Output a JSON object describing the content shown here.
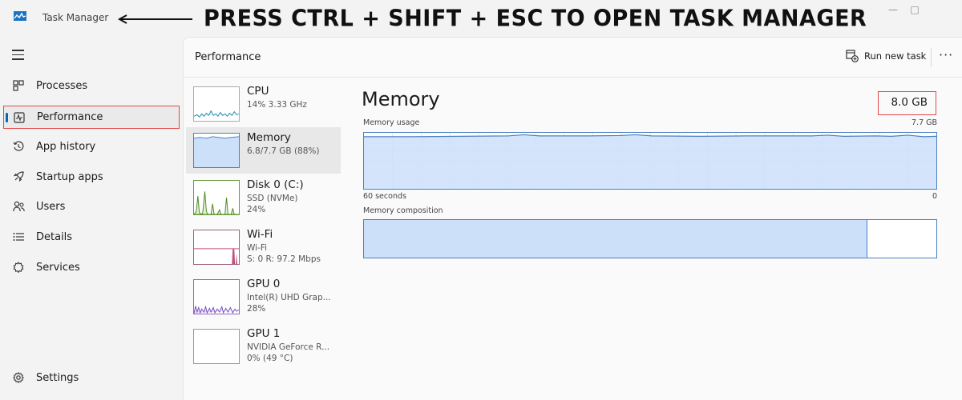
{
  "window": {
    "title": "Task Manager",
    "annotation": "PRESS CTRL + SHIFT + ESC TO OPEN TASK MANAGER",
    "minimize": "—",
    "maximize": "□"
  },
  "sidebar": {
    "items": [
      {
        "label": "Processes",
        "icon": "processes-icon"
      },
      {
        "label": "Performance",
        "icon": "performance-icon",
        "active": true
      },
      {
        "label": "App history",
        "icon": "history-icon"
      },
      {
        "label": "Startup apps",
        "icon": "startup-icon"
      },
      {
        "label": "Users",
        "icon": "users-icon"
      },
      {
        "label": "Details",
        "icon": "details-icon"
      },
      {
        "label": "Services",
        "icon": "services-icon"
      }
    ],
    "settings": "Settings"
  },
  "header": {
    "title": "Performance",
    "run_new_task": "Run new task",
    "more": "···"
  },
  "resources": [
    {
      "name": "CPU",
      "sub": "14% 3.33 GHz",
      "sub2": ""
    },
    {
      "name": "Memory",
      "sub": "6.8/7.7 GB (88%)",
      "sub2": ""
    },
    {
      "name": "Disk 0 (C:)",
      "sub": "SSD (NVMe)",
      "sub2": "24%"
    },
    {
      "name": "Wi-Fi",
      "sub": "Wi-Fi",
      "sub2": "S: 0 R: 97.2 Mbps"
    },
    {
      "name": "GPU 0",
      "sub": "Intel(R) UHD Grap...",
      "sub2": "28%"
    },
    {
      "name": "GPU 1",
      "sub": "NVIDIA GeForce R...",
      "sub2": "0% (49 °C)"
    }
  ],
  "detail": {
    "title": "Memory",
    "capacity": "8.0 GB",
    "usage_label": "Memory usage",
    "usage_max": "7.7 GB",
    "time_label": "60 seconds",
    "time_end": "0",
    "composition_label": "Memory composition",
    "composition_used_fraction": 0.88
  },
  "colors": {
    "accent": "#0067c0",
    "highlight": "#e24a4a",
    "memory_line": "#4a7fc1",
    "memory_fill": "#cce0fa"
  }
}
